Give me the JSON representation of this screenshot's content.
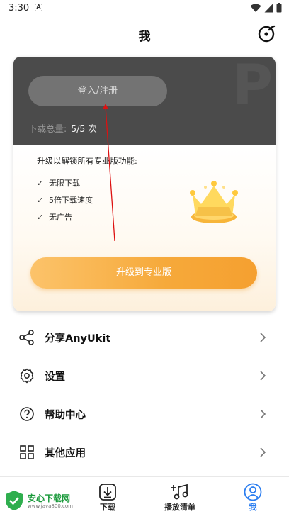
{
  "status_bar": {
    "time": "3:30",
    "notif_glyph": "A"
  },
  "header": {
    "title": "我"
  },
  "account": {
    "watermark": "P",
    "login_label": "登入/注册",
    "download_total_label": "下载总量:",
    "download_total_value": "5/5 次"
  },
  "upgrade": {
    "heading": "升级以解锁所有专业版功能:",
    "features": [
      "无限下载",
      "5倍下载速度",
      "无广告"
    ],
    "button_label": "升级到专业版"
  },
  "menu": [
    {
      "label": "分享AnyUkit",
      "icon": "share-icon"
    },
    {
      "label": "设置",
      "icon": "gear-icon"
    },
    {
      "label": "帮助中心",
      "icon": "help-icon"
    },
    {
      "label": "其他应用",
      "icon": "apps-grid-icon"
    }
  ],
  "tabs": [
    {
      "label": "下载",
      "icon": "download-icon",
      "active": false
    },
    {
      "label": "播放清单",
      "icon": "playlist-icon",
      "active": false
    },
    {
      "label": "我",
      "icon": "profile-icon",
      "active": true
    }
  ],
  "site_badge": {
    "name": "安心下载网",
    "url": "www.java800.com"
  },
  "colors": {
    "accent": "#2a7df0",
    "card_dark": "#4b4b4b",
    "upgrade_orange": "#f6a93a"
  }
}
